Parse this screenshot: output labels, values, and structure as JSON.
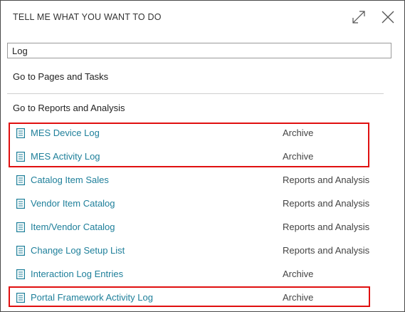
{
  "dialog": {
    "title": "TELL ME WHAT YOU WANT TO DO",
    "search_value": "Log",
    "groups": {
      "pages": "Go to Pages and Tasks",
      "reports": "Go to Reports and Analysis"
    }
  },
  "icons": {
    "expand": "expand-icon",
    "close": "close-icon",
    "item": "document-icon"
  },
  "colors": {
    "link": "#1e7f9a",
    "highlight": "#e01010",
    "border": "#4a4a4a"
  },
  "results": [
    {
      "name": "MES Device Log",
      "category": "Archive"
    },
    {
      "name": "MES Activity Log",
      "category": "Archive"
    },
    {
      "name": "Catalog Item Sales",
      "category": "Reports and Analysis"
    },
    {
      "name": "Vendor Item Catalog",
      "category": "Reports and Analysis"
    },
    {
      "name": "Item/Vendor Catalog",
      "category": "Reports and Analysis"
    },
    {
      "name": "Change Log Setup List",
      "category": "Reports and Analysis"
    },
    {
      "name": "Interaction Log Entries",
      "category": "Archive"
    },
    {
      "name": "Portal Framework Activity Log",
      "category": "Archive"
    }
  ]
}
